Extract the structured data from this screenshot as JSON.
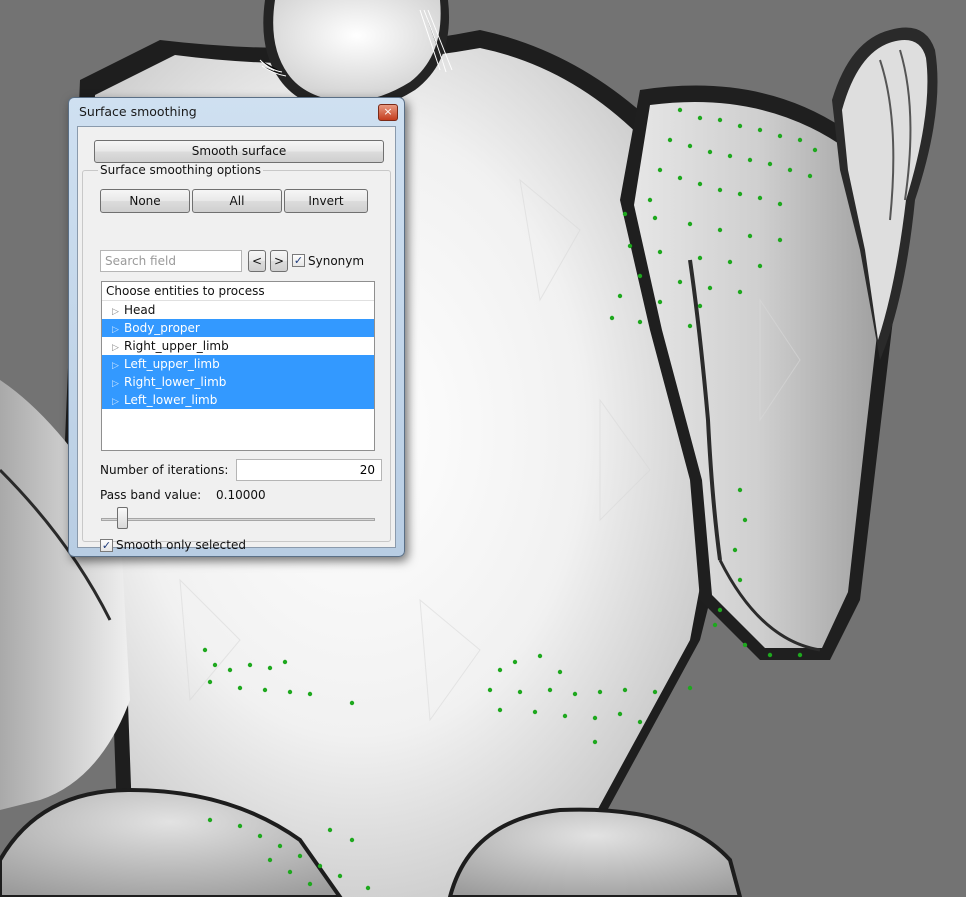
{
  "dialog": {
    "title": "Surface smoothing",
    "close_glyph": "×",
    "smooth_button": "Smooth surface",
    "options_group_label": "Surface smoothing options",
    "none_button": "None",
    "all_button": "All",
    "invert_button": "Invert",
    "search_placeholder": "Search field",
    "prev_button": "<",
    "next_button": ">",
    "synonym_label": "Synonym",
    "synonym_checked": true,
    "tree_header": "Choose entities to process",
    "entities": [
      {
        "label": "Head",
        "selected": false
      },
      {
        "label": "Body_proper",
        "selected": true
      },
      {
        "label": "Right_upper_limb",
        "selected": false
      },
      {
        "label": "Left_upper_limb",
        "selected": true
      },
      {
        "label": "Right_lower_limb",
        "selected": true
      },
      {
        "label": "Left_lower_limb",
        "selected": true
      }
    ],
    "iterations_label": "Number of iterations:",
    "iterations_value": "20",
    "pass_band_label": "Pass band value:",
    "pass_band_value": "0.10000",
    "slider_fraction": 0.06,
    "smooth_selected_label": "Smooth only selected",
    "smooth_selected_checked": true
  },
  "colors": {
    "selection": "#3399ff",
    "background": "#737373",
    "mesh_light": "#f2f2f2",
    "mesh_dark": "#1e1e1e",
    "marker": "#1ea81e"
  }
}
